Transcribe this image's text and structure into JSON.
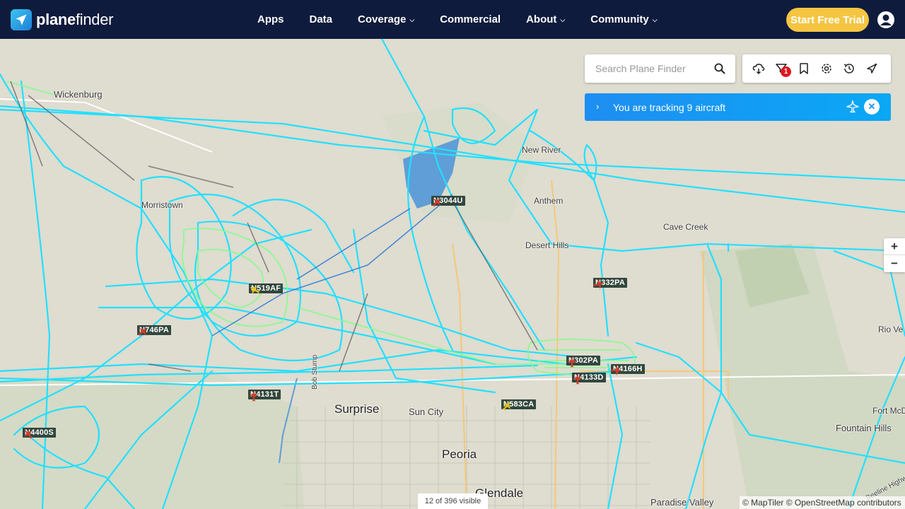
{
  "brand": {
    "name_plane": "plane",
    "name_finder": "finder"
  },
  "nav": {
    "items": [
      {
        "label": "Apps",
        "has_menu": false
      },
      {
        "label": "Data",
        "has_menu": false
      },
      {
        "label": "Coverage",
        "has_menu": true
      },
      {
        "label": "Commercial",
        "has_menu": false
      },
      {
        "label": "About",
        "has_menu": true
      },
      {
        "label": "Community",
        "has_menu": true
      }
    ],
    "trial_label": "Start Free Trial"
  },
  "search": {
    "placeholder": "Search Plane Finder"
  },
  "toolbar": {
    "icons": [
      "weather-icon",
      "filter-icon",
      "bookmark-icon",
      "settings-icon",
      "history-icon",
      "airport-icon"
    ],
    "filter_badge": "1"
  },
  "tracking": {
    "text": "You are tracking 9 aircraft"
  },
  "zoom": {
    "in": "+",
    "out": "−"
  },
  "places": [
    "Wickenburg",
    "New River",
    "Anthem",
    "Cave Creek",
    "Desert Hills",
    "Surprise",
    "Sun City",
    "Peoria",
    "Glendale",
    "Fountain Hills",
    "Fort McD",
    "Rio Ve",
    "Paradise Valley",
    "Bob Stump",
    "Morristown",
    "Beeline Highw"
  ],
  "aircraft": [
    {
      "callsign": "N3044U",
      "color": "#d23a2a"
    },
    {
      "callsign": "N519AF",
      "color": "#e7c51c"
    },
    {
      "callsign": "N746PA",
      "color": "#d23a2a"
    },
    {
      "callsign": "N332PA",
      "color": "#d23a2a"
    },
    {
      "callsign": "N302PA",
      "color": "#d23a2a"
    },
    {
      "callsign": "N4166H",
      "color": "#d23a2a"
    },
    {
      "callsign": "N4133D",
      "color": "#d23a2a"
    },
    {
      "callsign": "N4131T",
      "color": "#d23a2a"
    },
    {
      "callsign": "N583CA",
      "color": "#e7c51c"
    },
    {
      "callsign": "N4400S",
      "color": "#d23a2a"
    }
  ],
  "status": {
    "visible": "12 of 396 visible",
    "attribution": "© MapTiler © OpenStreetMap contributors"
  },
  "colors": {
    "nav_bg": "#0f1b3d",
    "trial_bg": "#f5c542",
    "track": "#22e0ff",
    "track_green": "#7dff8a",
    "tracking_bar": "#1e8ef2"
  }
}
